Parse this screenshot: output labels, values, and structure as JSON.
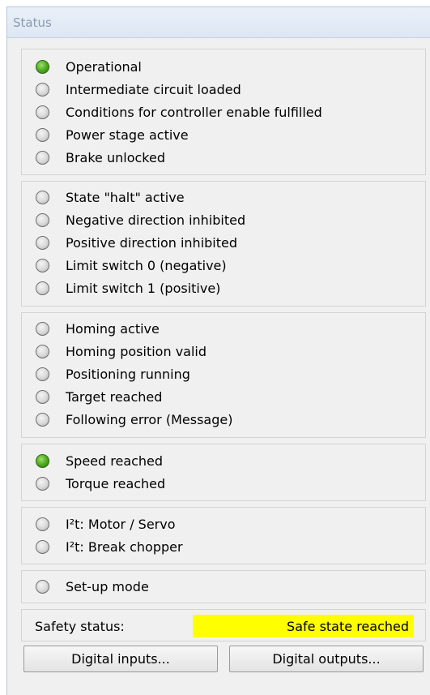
{
  "window": {
    "title": "Status"
  },
  "groups": [
    {
      "items": [
        {
          "label": "Operational",
          "state": "on"
        },
        {
          "label": "Intermediate circuit loaded",
          "state": "off"
        },
        {
          "label": "Conditions for controller enable fulfilled",
          "state": "off"
        },
        {
          "label": "Power stage active",
          "state": "off"
        },
        {
          "label": "Brake unlocked",
          "state": "off"
        }
      ]
    },
    {
      "items": [
        {
          "label": "State \"halt\" active",
          "state": "off"
        },
        {
          "label": "Negative direction inhibited",
          "state": "off"
        },
        {
          "label": "Positive direction inhibited",
          "state": "off"
        },
        {
          "label": "Limit switch 0 (negative)",
          "state": "off"
        },
        {
          "label": "Limit switch 1 (positive)",
          "state": "off"
        }
      ]
    },
    {
      "items": [
        {
          "label": "Homing active",
          "state": "off"
        },
        {
          "label": "Homing position valid",
          "state": "off"
        },
        {
          "label": "Positioning running",
          "state": "off"
        },
        {
          "label": "Target reached",
          "state": "off"
        },
        {
          "label": "Following error (Message)",
          "state": "off"
        }
      ]
    },
    {
      "items": [
        {
          "label": "Speed reached",
          "state": "on"
        },
        {
          "label": "Torque reached",
          "state": "off"
        }
      ]
    },
    {
      "items": [
        {
          "label": "I²t: Motor / Servo",
          "state": "off"
        },
        {
          "label": "I²t: Break chopper",
          "state": "off"
        }
      ]
    },
    {
      "items": [
        {
          "label": "Set-up mode",
          "state": "off"
        }
      ]
    }
  ],
  "safety": {
    "label": "Safety status:",
    "value": "Safe state reached",
    "value_color": "#ffff00"
  },
  "buttons": {
    "digital_inputs": "Digital inputs...",
    "digital_outputs": "Digital outputs..."
  },
  "colors": {
    "led_on": "#4aa51e",
    "led_off": "#d8d8d8"
  }
}
